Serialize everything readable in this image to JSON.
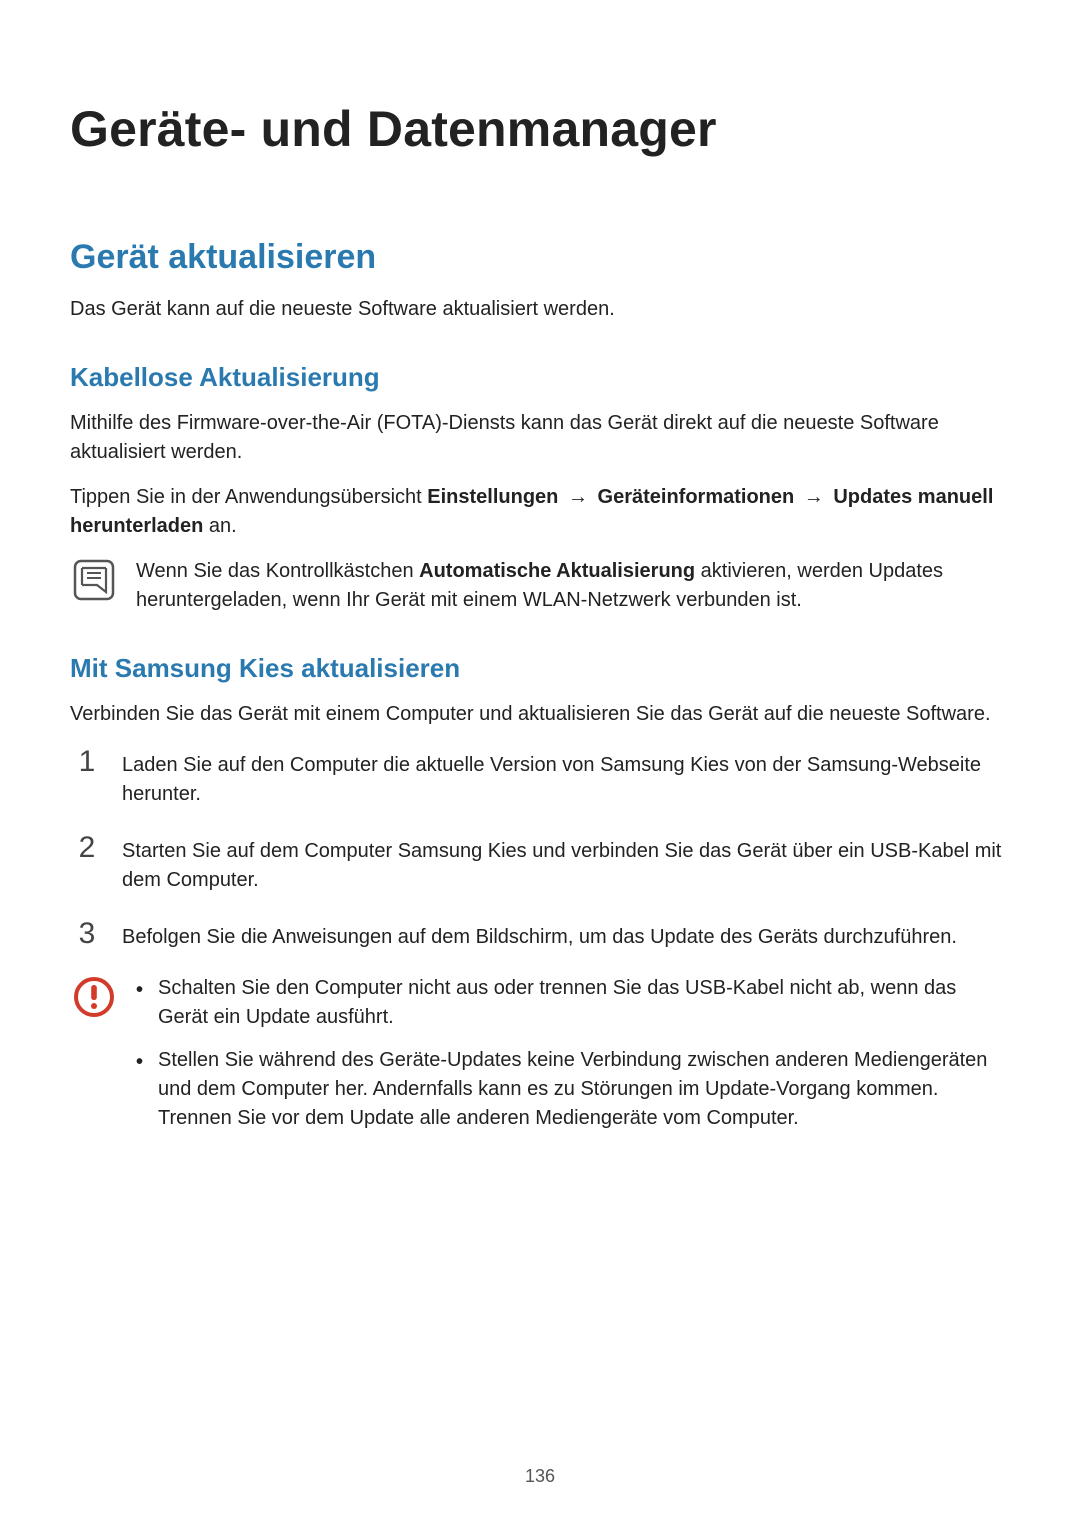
{
  "title": "Geräte- und Datenmanager",
  "section1": {
    "heading": "Gerät aktualisieren",
    "intro": "Das Gerät kann auf die neueste Software aktualisiert werden."
  },
  "subsection_wireless": {
    "heading": "Kabellose Aktualisierung",
    "p1": "Mithilfe des Firmware-over-the-Air (FOTA)-Diensts kann das Gerät direkt auf die neueste Software aktualisiert werden.",
    "p2_pre": "Tippen Sie in der Anwendungsübersicht ",
    "p2_b1": "Einstellungen",
    "p2_arrow1": "→",
    "p2_b2": "Geräteinformationen",
    "p2_arrow2": "→",
    "p2_b3": "Updates manuell herunterladen",
    "p2_post": " an.",
    "note_pre": "Wenn Sie das Kontrollkästchen ",
    "note_bold": "Automatische Aktualisierung",
    "note_post": " aktivieren, werden Updates heruntergeladen, wenn Ihr Gerät mit einem WLAN-Netzwerk verbunden ist."
  },
  "subsection_kies": {
    "heading": "Mit Samsung Kies aktualisieren",
    "intro": "Verbinden Sie das Gerät mit einem Computer und aktualisieren Sie das Gerät auf die neueste Software.",
    "steps": [
      "Laden Sie auf den Computer die aktuelle Version von Samsung Kies von der Samsung-Webseite herunter.",
      "Starten Sie auf dem Computer Samsung Kies und verbinden Sie das Gerät über ein USB-Kabel mit dem Computer.",
      "Befolgen Sie die Anweisungen auf dem Bildschirm, um das Update des Geräts durchzuführen."
    ],
    "warnings": [
      "Schalten Sie den Computer nicht aus oder trennen Sie das USB-Kabel nicht ab, wenn das Gerät ein Update ausführt.",
      "Stellen Sie während des Geräte-Updates keine Verbindung zwischen anderen Mediengeräten und dem Computer her. Andernfalls kann es zu Störungen im Update-Vorgang kommen. Trennen Sie vor dem Update alle anderen Mediengeräte vom Computer."
    ]
  },
  "numbers": {
    "n1": "1",
    "n2": "2",
    "n3": "3"
  },
  "bullet": "•",
  "page_number": "136"
}
